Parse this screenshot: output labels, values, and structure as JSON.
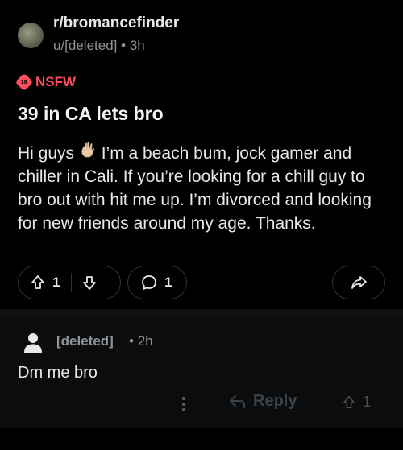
{
  "post": {
    "subreddit": "r/bromancefinder",
    "author": "u/[deleted]",
    "age": "3h",
    "nsfw_label": "NSFW",
    "title": "39 in CA lets bro",
    "body_before_emoji": "Hi guys ",
    "body_after_emoji": " I’m a beach bum, jock gamer and chiller in Cali. If you’re looking for a chill guy to bro out with hit me up. I’m divorced and looking for new friends around my age. Thanks.",
    "upvotes": "1",
    "comments": "1"
  },
  "comment": {
    "author": "[deleted]",
    "age": "2h",
    "body": "Dm me bro",
    "reply_label": "Reply",
    "upvotes": "1"
  },
  "colors": {
    "nsfw": "#ff4d5c",
    "meta": "#8f9497",
    "text": "#e6e8ea",
    "background": "#000000"
  },
  "icons": [
    "upvote-icon",
    "downvote-icon",
    "comment-icon",
    "share-icon",
    "more-icon",
    "reply-icon",
    "waving-hand-icon",
    "nsfw-icon"
  ]
}
